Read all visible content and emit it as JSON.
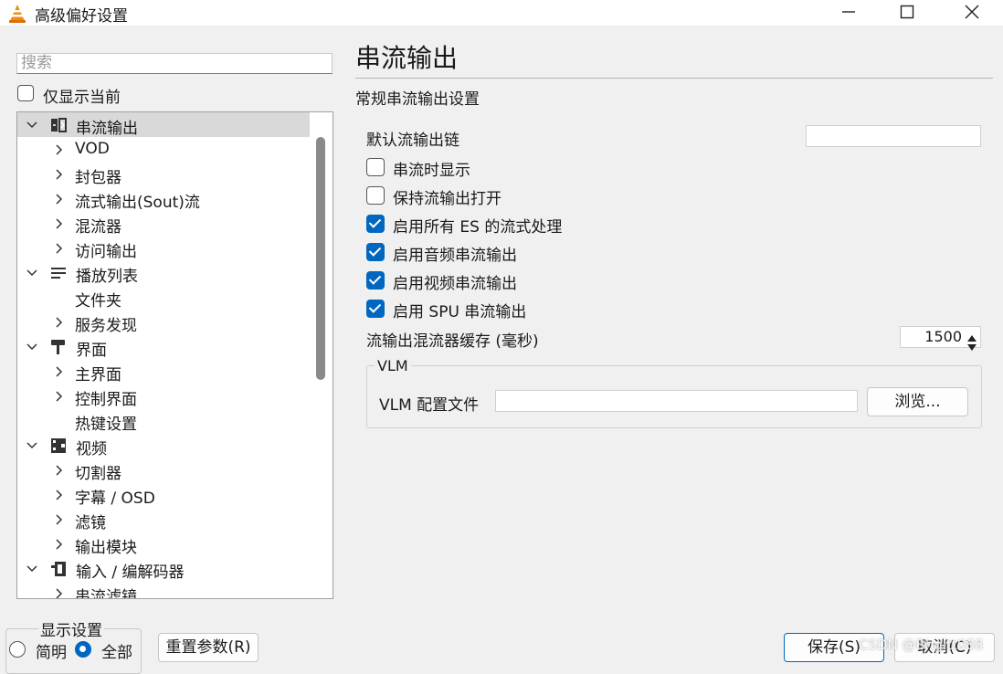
{
  "window": {
    "title": "高级偏好设置",
    "controls": [
      "minimize",
      "maximize",
      "close"
    ]
  },
  "left": {
    "search_placeholder": "搜索",
    "show_current_only": {
      "label": "仅显示当前",
      "checked": false
    },
    "tree": [
      {
        "label": "串流输出",
        "level": 0,
        "expanded": true,
        "icon": "stream-output-icon",
        "selected": true
      },
      {
        "label": "VOD",
        "level": 1,
        "has_children": true
      },
      {
        "label": "封包器",
        "level": 1,
        "has_children": true
      },
      {
        "label": "流式输出(Sout)流",
        "level": 1,
        "has_children": true
      },
      {
        "label": "混流器",
        "level": 1,
        "has_children": true
      },
      {
        "label": "访问输出",
        "level": 1,
        "has_children": true
      },
      {
        "label": "播放列表",
        "level": 0,
        "expanded": true,
        "icon": "playlist-icon"
      },
      {
        "label": "文件夹",
        "level": 1,
        "has_children": false
      },
      {
        "label": "服务发现",
        "level": 1,
        "has_children": true
      },
      {
        "label": "界面",
        "level": 0,
        "expanded": true,
        "icon": "paint-roller-icon"
      },
      {
        "label": "主界面",
        "level": 1,
        "has_children": true
      },
      {
        "label": "控制界面",
        "level": 1,
        "has_children": true
      },
      {
        "label": "热键设置",
        "level": 1,
        "has_children": false
      },
      {
        "label": "视频",
        "level": 0,
        "expanded": true,
        "icon": "video-icon"
      },
      {
        "label": "切割器",
        "level": 1,
        "has_children": true
      },
      {
        "label": "字幕 / OSD",
        "level": 1,
        "has_children": true
      },
      {
        "label": "滤镜",
        "level": 1,
        "has_children": true
      },
      {
        "label": "输出模块",
        "level": 1,
        "has_children": true
      },
      {
        "label": "输入 / 编解码器",
        "level": 0,
        "expanded": true,
        "icon": "input-codec-icon"
      },
      {
        "label": "串流滤镜",
        "level": 1,
        "has_children": true
      }
    ],
    "display_settings": {
      "legend": "显示设置",
      "simple": {
        "label": "简明",
        "selected": false
      },
      "all": {
        "label": "全部",
        "selected": true
      }
    },
    "reset_button": "重置参数(R)"
  },
  "main": {
    "heading": "串流输出",
    "subtitle": "常规串流输出设置",
    "default_chain": {
      "label": "默认流输出链",
      "value": ""
    },
    "options": [
      {
        "label": "串流时显示",
        "checked": false
      },
      {
        "label": "保持流输出打开",
        "checked": false
      },
      {
        "label": "启用所有 ES 的流式处理",
        "checked": true
      },
      {
        "label": "启用音频串流输出",
        "checked": true
      },
      {
        "label": "启用视频串流输出",
        "checked": true
      },
      {
        "label": "启用 SPU 串流输出",
        "checked": true
      }
    ],
    "mux_cache": {
      "label": "流输出混流器缓存 (毫秒)",
      "value": "1500"
    },
    "vlm": {
      "title": "VLM",
      "config_label": "VLM 配置文件",
      "config_value": "",
      "browse_button": "浏览..."
    }
  },
  "footer": {
    "save_button": "保存(S)",
    "cancel_button": "取消(C)",
    "watermark": "CSDN @Bhgitt088"
  },
  "colors": {
    "accent": "#0067c0",
    "selection": "#d9d9d9"
  }
}
